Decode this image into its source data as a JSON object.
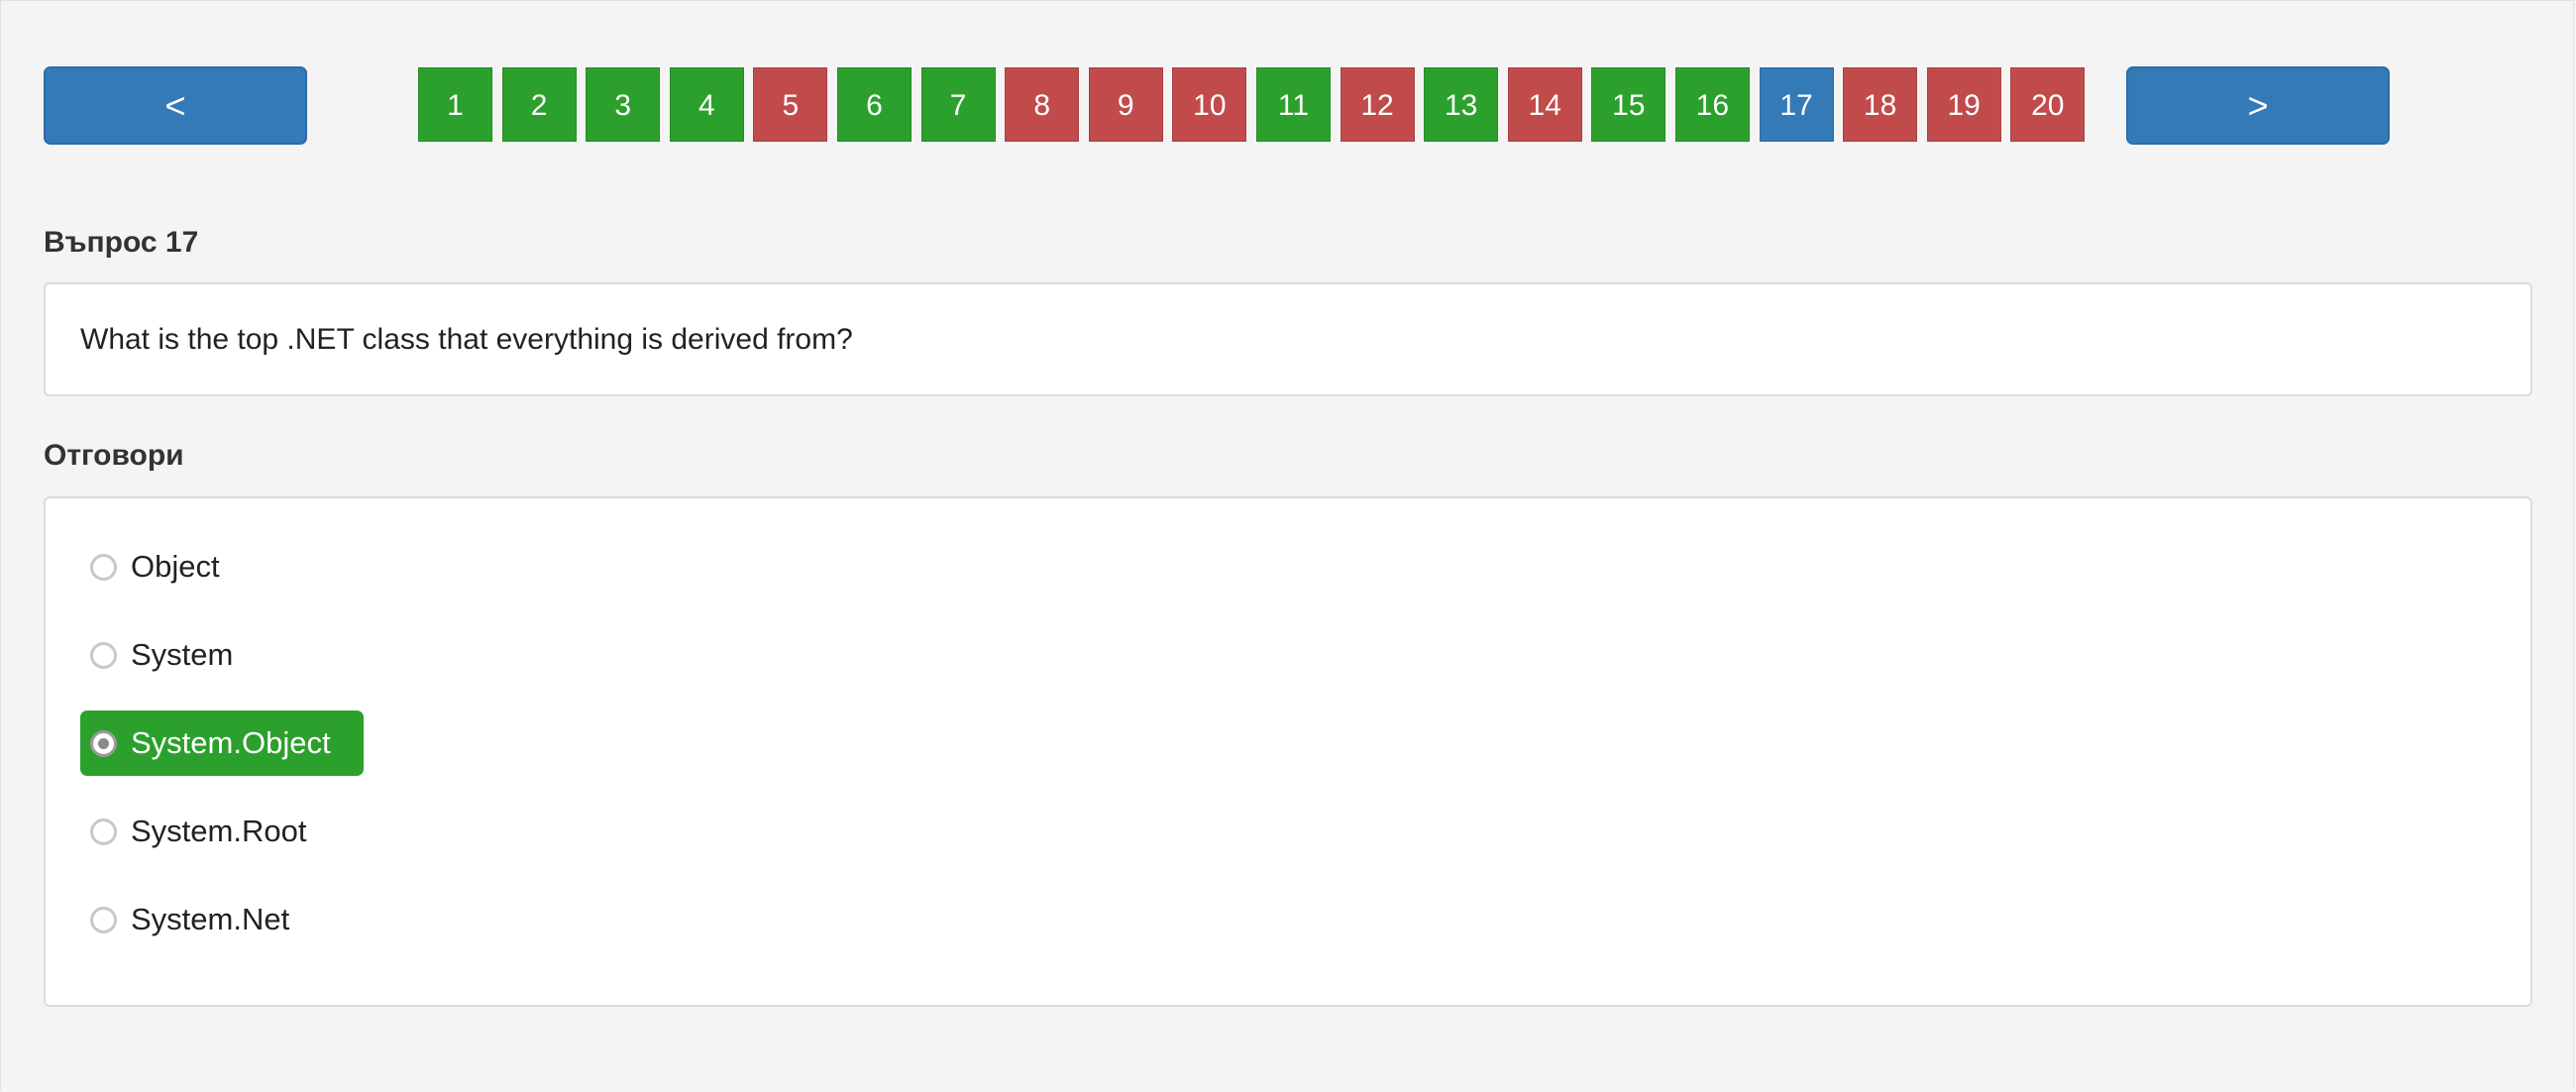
{
  "nav": {
    "prev_label": "<",
    "next_label": ">"
  },
  "pager": {
    "current": 17,
    "pages": [
      {
        "label": "1",
        "status": "correct"
      },
      {
        "label": "2",
        "status": "correct"
      },
      {
        "label": "3",
        "status": "correct"
      },
      {
        "label": "4",
        "status": "correct"
      },
      {
        "label": "5",
        "status": "wrong"
      },
      {
        "label": "6",
        "status": "correct"
      },
      {
        "label": "7",
        "status": "correct"
      },
      {
        "label": "8",
        "status": "wrong"
      },
      {
        "label": "9",
        "status": "wrong"
      },
      {
        "label": "10",
        "status": "wrong"
      },
      {
        "label": "11",
        "status": "correct"
      },
      {
        "label": "12",
        "status": "wrong"
      },
      {
        "label": "13",
        "status": "correct"
      },
      {
        "label": "14",
        "status": "wrong"
      },
      {
        "label": "15",
        "status": "correct"
      },
      {
        "label": "16",
        "status": "correct"
      },
      {
        "label": "17",
        "status": "current"
      },
      {
        "label": "18",
        "status": "wrong"
      },
      {
        "label": "19",
        "status": "wrong"
      },
      {
        "label": "20",
        "status": "wrong"
      }
    ]
  },
  "question": {
    "title": "Въпрос 17",
    "text": "What is the top .NET class that everything is derived from?"
  },
  "answers": {
    "title": "Отговори",
    "options": [
      {
        "label": "Object",
        "selected": false
      },
      {
        "label": "System",
        "selected": false
      },
      {
        "label": "System.Object",
        "selected": true
      },
      {
        "label": "System.Root",
        "selected": false
      },
      {
        "label": "System.Net",
        "selected": false
      }
    ]
  },
  "colors": {
    "correct": "#2ca02c",
    "wrong": "#c14b4b",
    "current": "#337ab7",
    "nav_button": "#337ab7",
    "background": "#f4f4f4"
  }
}
